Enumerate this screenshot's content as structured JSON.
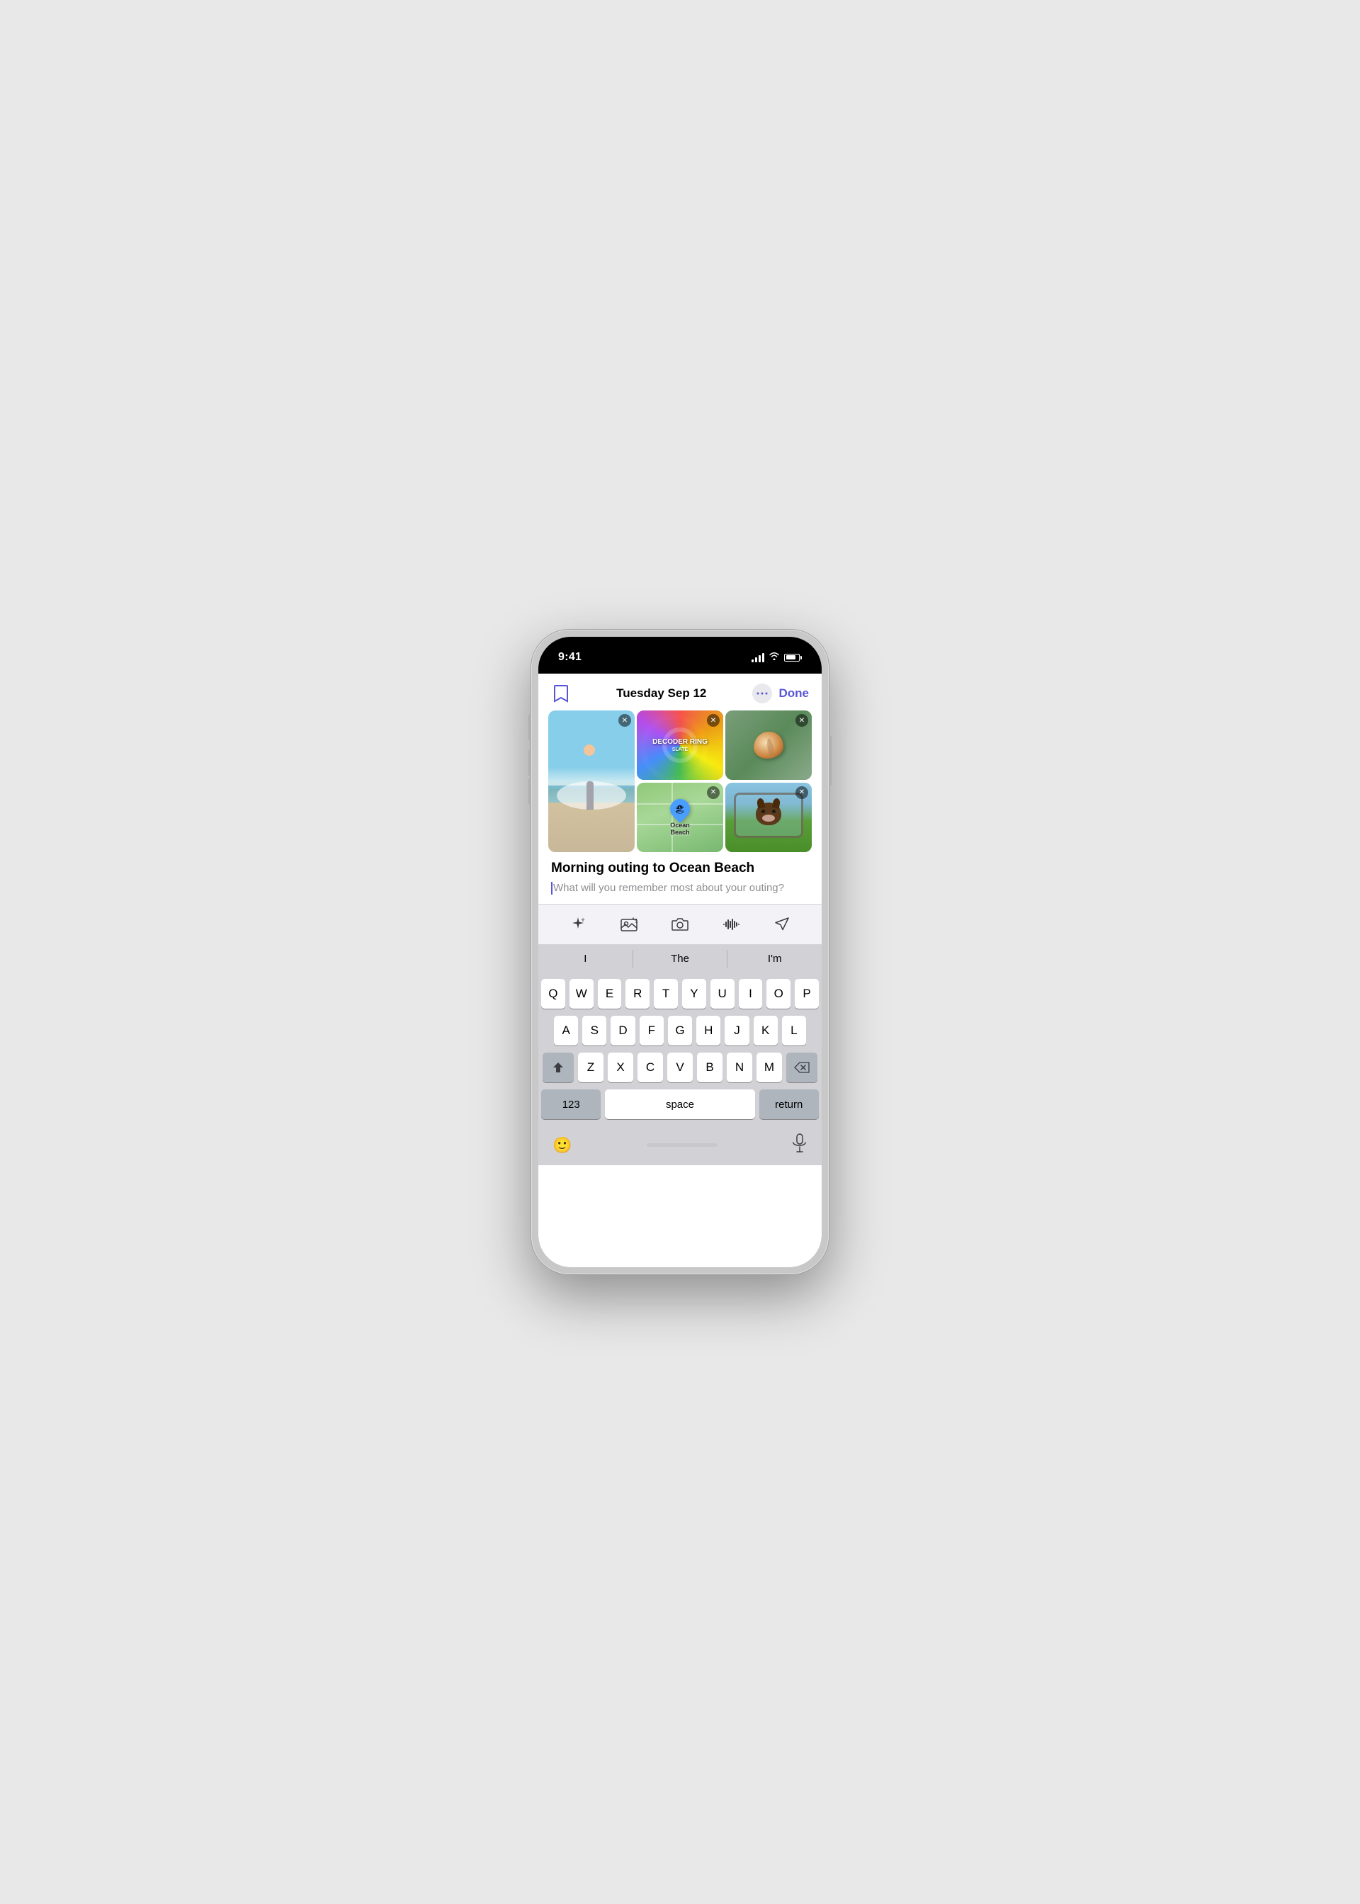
{
  "phone": {
    "status_bar": {
      "time": "9:41",
      "signal_label": "signal",
      "wifi_label": "wifi",
      "battery_label": "battery"
    },
    "header": {
      "date": "Tuesday Sep 12",
      "done_label": "Done",
      "bookmark_label": "bookmark",
      "more_label": "more options"
    },
    "media_items": [
      {
        "id": "beach-photo",
        "type": "photo",
        "label": "Beach surfer photo",
        "size": "large"
      },
      {
        "id": "decoder-ring",
        "type": "podcast",
        "label": "Decoder Ring podcast",
        "title": "DECODER RING",
        "subtitle": "SLATE",
        "size": "small"
      },
      {
        "id": "seashell",
        "type": "photo",
        "label": "Seashell photo",
        "size": "small"
      },
      {
        "id": "ocean-beach-map",
        "type": "map",
        "label": "Ocean Beach map",
        "name": "Ocean Beach",
        "size": "small"
      },
      {
        "id": "dog-car",
        "type": "photo",
        "label": "Dog in car photo",
        "size": "small"
      }
    ],
    "journal": {
      "title": "Morning outing to Ocean Beach",
      "prompt_placeholder": "What will you remember most about your outing?"
    },
    "toolbar": {
      "ai_icon": "✦",
      "photos_icon": "🖼",
      "camera_icon": "📷",
      "audio_icon": "audio-waveform",
      "location_icon": "➤"
    },
    "autocomplete": {
      "suggestions": [
        "I",
        "The",
        "I'm"
      ]
    },
    "keyboard": {
      "row1": [
        "Q",
        "W",
        "E",
        "R",
        "T",
        "Y",
        "U",
        "I",
        "O",
        "P"
      ],
      "row2": [
        "A",
        "S",
        "D",
        "F",
        "G",
        "H",
        "J",
        "K",
        "L"
      ],
      "row3": [
        "Z",
        "X",
        "C",
        "V",
        "B",
        "N",
        "M"
      ],
      "special": {
        "numbers": "123",
        "space": "space",
        "return": "return",
        "shift": "⬆",
        "backspace": "⌫"
      }
    },
    "bottom_bar": {
      "emoji_label": "emoji",
      "mic_label": "microphone"
    }
  }
}
